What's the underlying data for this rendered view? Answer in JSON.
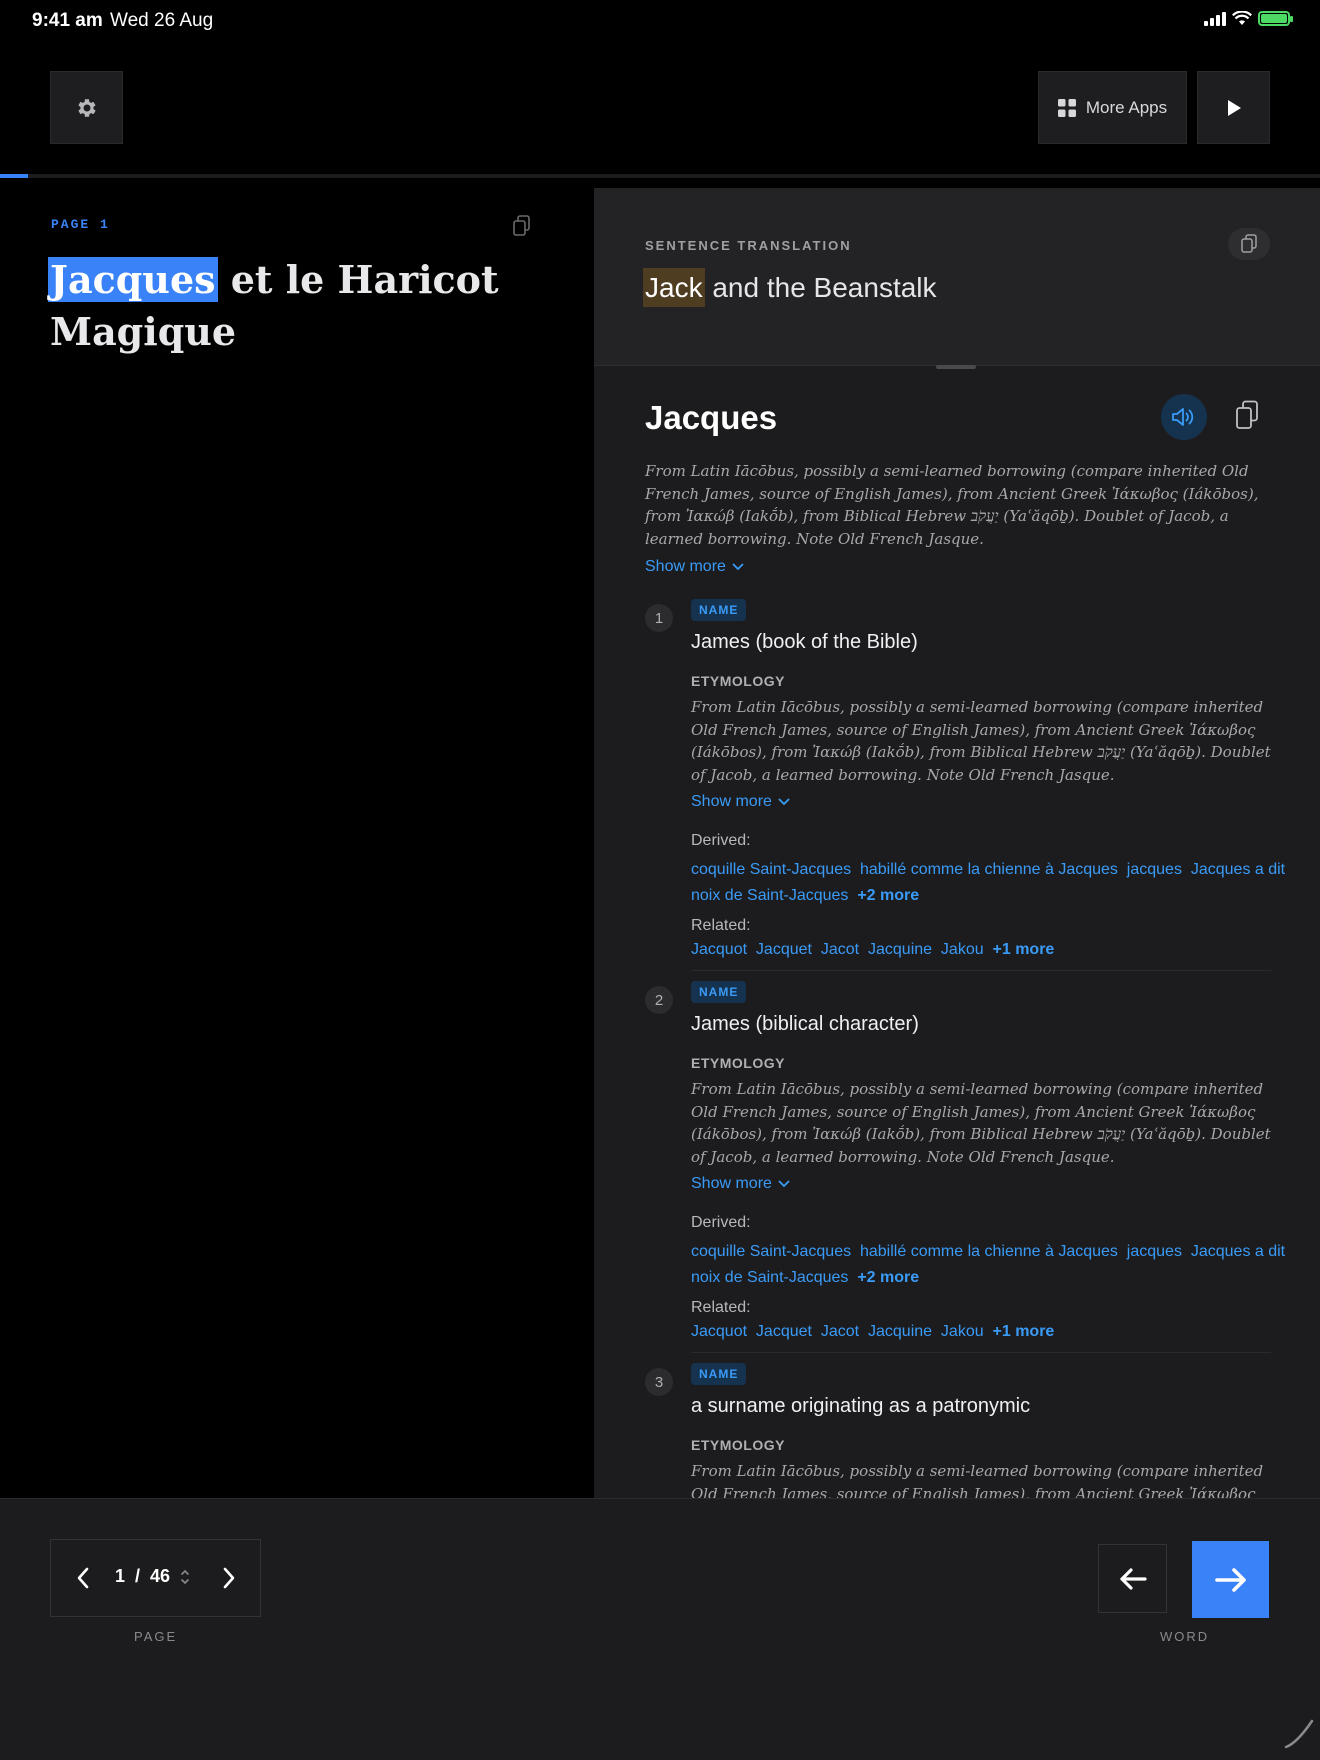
{
  "status_bar": {
    "time": "9:41 am",
    "date": "Wed 26 Aug"
  },
  "toolbar": {
    "more_apps_label": "More Apps"
  },
  "reader": {
    "page_label": "PAGE 1",
    "text_highlight": "Jacques",
    "text_rest": " et le Haricot Magique"
  },
  "translation": {
    "label": "SENTENCE TRANSLATION",
    "highlight": "Jack",
    "rest": " and the Beanstalk"
  },
  "entry": {
    "word": "Jacques",
    "etymology": "From Latin Iācōbus, possibly a semi-learned borrowing (compare inherited Old French James, source of English James), from Ancient Greek Ἰάκωβος (Iákōbos), from Ἰακώβ (Iakṓb), from Biblical Hebrew יַעֲקֹב (Yaʿăqōḇ). Doublet of Jacob, a learned borrowing. Note Old French Jasque.",
    "show_more": "Show more",
    "senses": [
      {
        "num": "1",
        "pos": "NAME",
        "definition": "James (book of the Bible)",
        "ety_head": "ETYMOLOGY",
        "etymology": "From Latin Iācōbus, possibly a semi-learned borrowing (compare inherited Old French James, source of English James), from Ancient Greek Ἰάκωβος (Iákōbos), from Ἰακώβ (Iakṓb), from Biblical Hebrew יַעֲקֹב (Yaʿăqōḇ). Doublet of Jacob, a learned borrowing. Note Old French Jasque.",
        "show_more": "Show more",
        "derived_head": "Derived:",
        "derived_links": "coquille Saint-Jacques  habillé comme la chienne à Jacques  jacques  Jacques a dit  noix de Saint-Jacques",
        "derived_more": "+2 more",
        "related_head": "Related:",
        "related_links": "Jacquot  Jacquet  Jacot  Jacquine  Jakou",
        "related_more": "+1 more"
      },
      {
        "num": "2",
        "pos": "NAME",
        "definition": "James (biblical character)",
        "ety_head": "ETYMOLOGY",
        "etymology": "From Latin Iācōbus, possibly a semi-learned borrowing (compare inherited Old French James, source of English James), from Ancient Greek Ἰάκωβος (Iákōbos), from Ἰακώβ (Iakṓb), from Biblical Hebrew יַעֲקֹב (Yaʿăqōḇ). Doublet of Jacob, a learned borrowing. Note Old French Jasque.",
        "show_more": "Show more",
        "derived_head": "Derived:",
        "derived_links": "coquille Saint-Jacques  habillé comme la chienne à Jacques  jacques  Jacques a dit  noix de Saint-Jacques",
        "derived_more": "+2 more",
        "related_head": "Related:",
        "related_links": "Jacquot  Jacquet  Jacot  Jacquine  Jakou",
        "related_more": "+1 more"
      },
      {
        "num": "3",
        "pos": "NAME",
        "definition": "a surname originating as a patronymic",
        "ety_head": "ETYMOLOGY",
        "etymology": "From Latin Iācōbus, possibly a semi-learned borrowing (compare inherited Old French James, source of English James), from Ancient Greek Ἰάκωβος (Iákōbos)."
      }
    ]
  },
  "pager": {
    "current": "1",
    "separator": "/",
    "total": "46",
    "label": "PAGE"
  },
  "word_nav": {
    "label": "WORD"
  },
  "colors": {
    "accent": "#3a82f7",
    "link": "#3a9bf7",
    "highlight_translation": "#4f3d22"
  },
  "progress": {
    "fraction": 0.021
  }
}
